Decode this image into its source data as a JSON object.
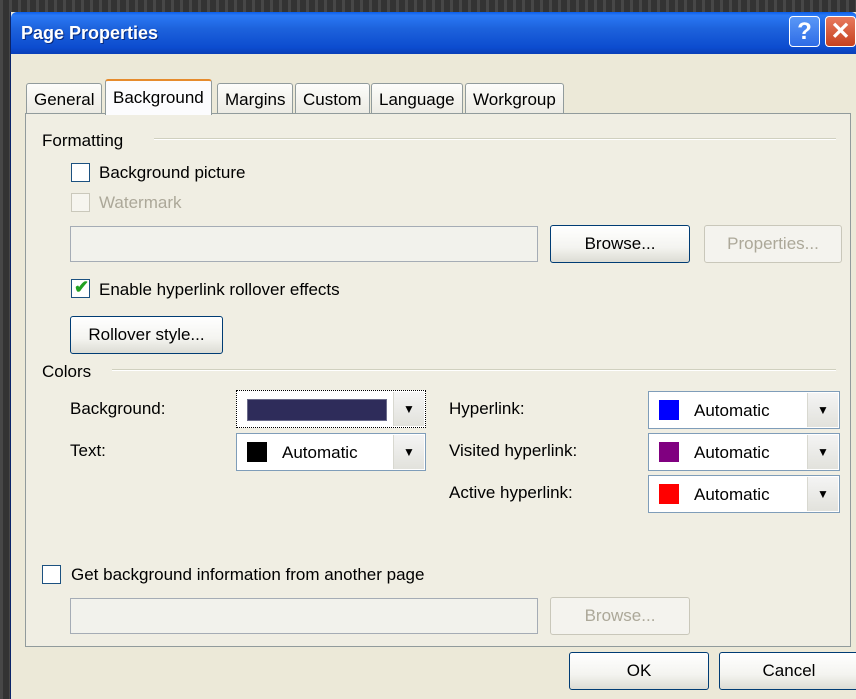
{
  "window": {
    "title": "Page Properties",
    "help_glyph": "?",
    "close_glyph": "✕"
  },
  "tabs": [
    {
      "label": "General"
    },
    {
      "label": "Background"
    },
    {
      "label": "Margins"
    },
    {
      "label": "Custom"
    },
    {
      "label": "Language"
    },
    {
      "label": "Workgroup"
    }
  ],
  "formatting": {
    "label": "Formatting",
    "background_picture": {
      "label": "Background picture",
      "checked": false
    },
    "watermark": {
      "label": "Watermark",
      "checked": false,
      "disabled": true
    },
    "picture_path": "",
    "browse_label": "Browse...",
    "properties_label": "Properties...",
    "rollover": {
      "label": "Enable hyperlink rollover effects",
      "checked": true
    },
    "rollover_style_label": "Rollover style..."
  },
  "colors": {
    "label": "Colors",
    "background": {
      "label": "Background:",
      "swatch": "#2e2c5a",
      "value": ""
    },
    "text": {
      "label": "Text:",
      "swatch": "#000000",
      "value": "Automatic"
    },
    "hyperlink": {
      "label": "Hyperlink:",
      "swatch": "#0000ff",
      "value": "Automatic"
    },
    "visited": {
      "label": "Visited hyperlink:",
      "swatch": "#800080",
      "value": "Automatic"
    },
    "active": {
      "label": "Active hyperlink:",
      "swatch": "#ff0000",
      "value": "Automatic"
    }
  },
  "other_page": {
    "label": "Get background information from another page",
    "checked": false,
    "path": "",
    "browse_label": "Browse..."
  },
  "footer": {
    "ok_label": "OK",
    "cancel_label": "Cancel"
  },
  "theme": {
    "title_blue": "#0c4ccf",
    "dialog_face": "#ece9d8",
    "tab_highlight": "#e68b2c"
  }
}
